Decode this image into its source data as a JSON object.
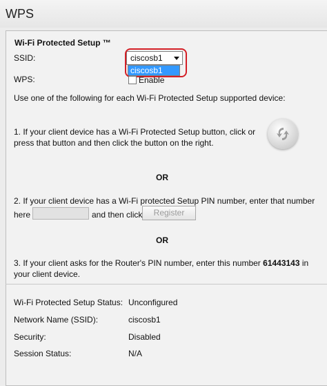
{
  "page": {
    "title": "WPS"
  },
  "section": {
    "title": "Wi-Fi Protected Setup ™"
  },
  "ssid": {
    "label": "SSID:",
    "selected": "ciscosb1",
    "options": [
      "ciscosb1"
    ]
  },
  "wps": {
    "label": "WPS:",
    "enable_label": "Enable"
  },
  "instructions": {
    "intro": "Use one of the following for each Wi-Fi Protected Setup supported device:",
    "step1_line1": "1. If your client device has a Wi-Fi Protected Setup button, click or",
    "step1_line2": "press that button and then click the button on the right.",
    "or1": "OR",
    "step2_line1": "2. If your client device has a Wi-Fi protected Setup PIN number, enter that number",
    "step2_here": "here",
    "step2_then": "and then click",
    "register_label": "Register",
    "or2": "OR",
    "step3_prefix": "3. If your client asks for the Router's PIN number, enter this number",
    "step3_pin": "61443143",
    "step3_suffix": "in",
    "step3_line2": "your client device."
  },
  "status": {
    "rows": [
      {
        "label": "Wi-Fi Protected Setup Status:",
        "value": "Unconfigured"
      },
      {
        "label": "Network Name (SSID):",
        "value": "ciscosb1"
      },
      {
        "label": "Security:",
        "value": "Disabled"
      },
      {
        "label": "Session Status:",
        "value": "N/A"
      }
    ]
  },
  "colors": {
    "highlight": "#d41f26",
    "selection": "#3399ff"
  },
  "icons": {
    "wps_button": "wps-arrows-icon",
    "dropdown": "chevron-down-icon"
  }
}
